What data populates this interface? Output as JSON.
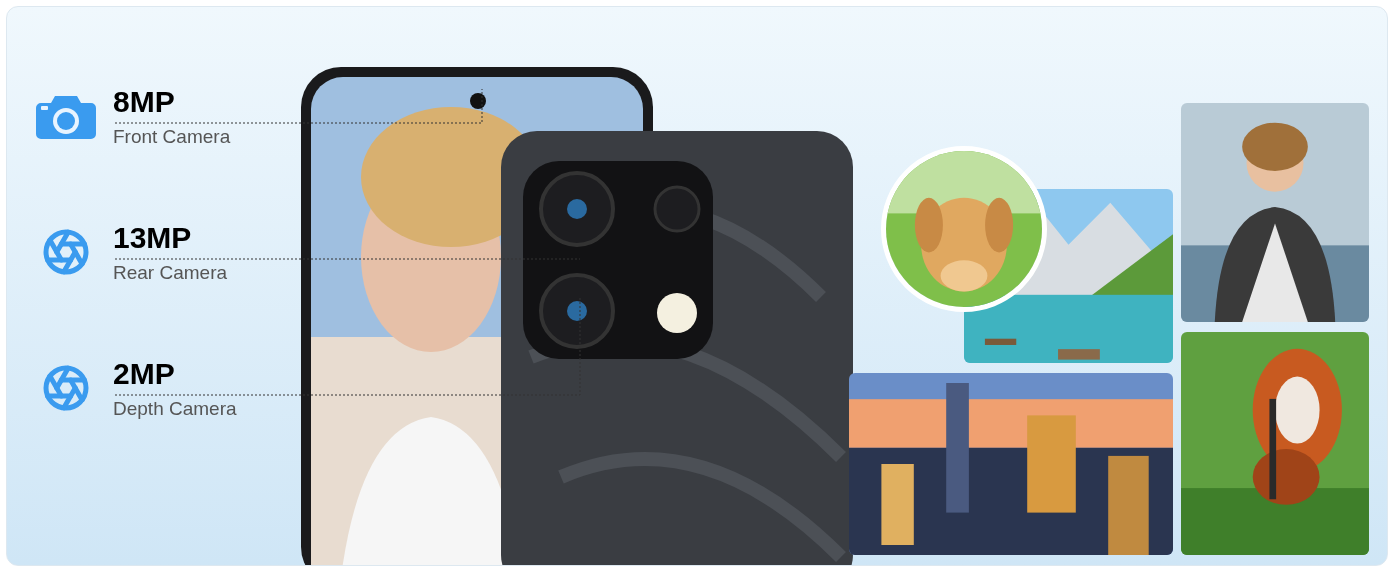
{
  "specs": [
    {
      "resolution": "8MP",
      "label": "Front Camera",
      "kind": "front"
    },
    {
      "resolution": "13MP",
      "label": "Rear Camera",
      "kind": "rear"
    },
    {
      "resolution": "2MP",
      "label": "Depth Camera",
      "kind": "rear"
    }
  ]
}
